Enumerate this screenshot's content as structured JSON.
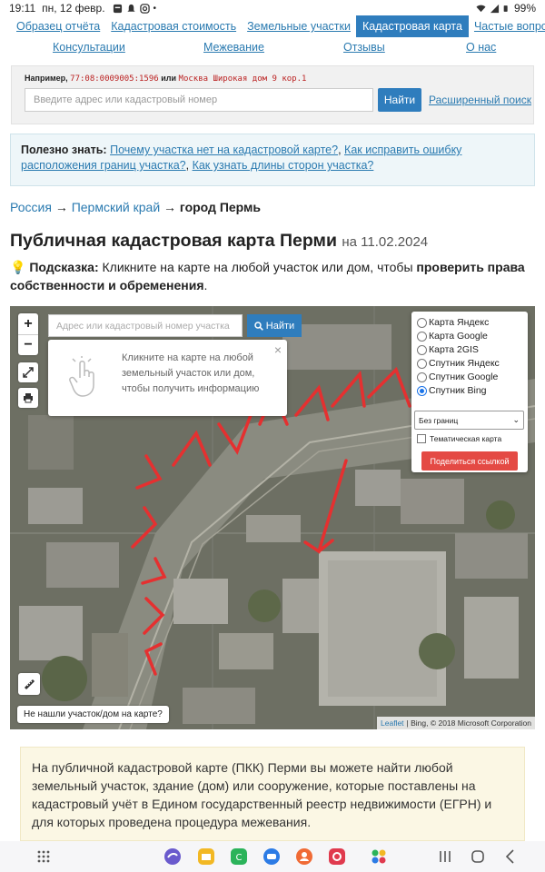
{
  "status_bar": {
    "time": "19:11",
    "date": "пн, 12 февр.",
    "battery": "99%"
  },
  "nav": {
    "row1": [
      "Образец отчёта",
      "Кадастровая стоимость",
      "Земельные участки",
      "Кадастровая карта",
      "Частые вопросы"
    ],
    "active_index": 3,
    "row2": [
      "Консультации",
      "Межевание",
      "Отзывы",
      "О нас"
    ]
  },
  "search": {
    "example_prefix": "Например,",
    "example_number": "77:08:0009005:1596",
    "example_or": "или",
    "example_address": "Москва Широкая дом 9 кор.1",
    "placeholder": "Введите адрес или кадастровый номер",
    "button": "Найти",
    "advanced": "Расширенный поиск"
  },
  "info": {
    "label": "Полезно знать:",
    "link1": "Почему участка нет на кадастровой карте?",
    "link2": "Как исправить ошибку расположения границ участка?",
    "link3": "Как узнать длины сторон участка?"
  },
  "breadcrumb": {
    "items": [
      "Россия",
      "Пермский край"
    ],
    "current": "город Пермь",
    "separator": "→"
  },
  "title": {
    "main": "Публичная кадастровая карта Перми",
    "date": "на 11.02.2024"
  },
  "hint": {
    "icon": "💡",
    "label": "Подсказка:",
    "text": "Кликните на карте на любой участок или дом, чтобы",
    "bold": "проверить права собственности и обременения",
    "end": "."
  },
  "map": {
    "search_placeholder": "Адрес или кадастровый номер участка",
    "search_button": "Найти",
    "zoom_in": "+",
    "zoom_out": "−",
    "tooltip": "Кликните на карте на любой земельный участок или дом, чтобы получить информацию",
    "tooltip_close": "×",
    "layers": [
      "Карта Яндекс",
      "Карта Google",
      "Карта 2GIS",
      "Спутник Яндекс",
      "Спутник Google",
      "Спутник Bing"
    ],
    "layer_selected": 5,
    "borders_select": "Без границ",
    "thematic_label": "Тематическая карта",
    "share_button": "Поделиться ссылкой",
    "not_found": "Не нашли участок/дом на карте?",
    "attribution_link": "Leaflet",
    "attribution_text": "| Bing, © 2018 Microsoft Corporation"
  },
  "description": "На публичной кадастровой карте (ПКК) Перми вы можете найти любой земельный участок, здание (дом) или сооружение, которые поставлены на кадастровый учёт в Едином государственный реестр недвижимости (ЕГРН) и для которых проведена процедура межевания.",
  "colors": {
    "accent": "#2f7dbd",
    "link": "#2a7ab0",
    "share": "#e44a44",
    "info_bg": "#eef6f9",
    "desc_bg": "#fbf7e4"
  }
}
